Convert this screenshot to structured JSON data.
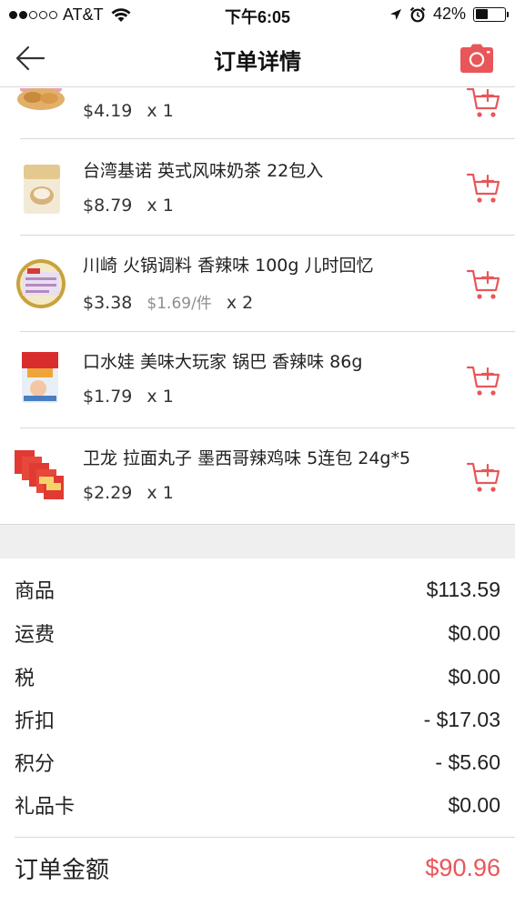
{
  "status_bar": {
    "carrier": "AT&T",
    "time": "下午6:05",
    "battery_percent": "42%",
    "battery_level": 0.42,
    "signal_bars": 2
  },
  "nav": {
    "title": "订单详情",
    "back_icon": "back-arrow-icon",
    "camera_icon": "camera-icon"
  },
  "colors": {
    "accent": "#e8565a",
    "divider": "#d9d9d9",
    "section_bg": "#efefef",
    "muted_text": "#8e8e8e"
  },
  "items": [
    {
      "name": "",
      "price": "$4.19",
      "unit_price": "",
      "quantity": "x 1"
    },
    {
      "name": "台湾基诺 英式风味奶茶 22包入",
      "price": "$8.79",
      "unit_price": "",
      "quantity": "x 1"
    },
    {
      "name": "川崎 火锅调料 香辣味 100g 儿时回忆",
      "price": "$3.38",
      "unit_price": "$1.69/件",
      "quantity": "x 2"
    },
    {
      "name": "口水娃 美味大玩家 锅巴 香辣味 86g",
      "price": "$1.79",
      "unit_price": "",
      "quantity": "x 1"
    },
    {
      "name": "卫龙 拉面丸子 墨西哥辣鸡味 5连包 24g*5",
      "price": "$2.29",
      "unit_price": "",
      "quantity": "x 1"
    }
  ],
  "summary": {
    "rows": [
      {
        "label": "商品",
        "value": "$113.59"
      },
      {
        "label": "运费",
        "value": "$0.00"
      },
      {
        "label": "税",
        "value": "$0.00"
      },
      {
        "label": "折扣",
        "value": "- $17.03"
      },
      {
        "label": "积分",
        "value": "- $5.60"
      },
      {
        "label": "礼品卡",
        "value": "$0.00"
      }
    ],
    "total_label": "订单金额",
    "total_value": "$90.96"
  }
}
